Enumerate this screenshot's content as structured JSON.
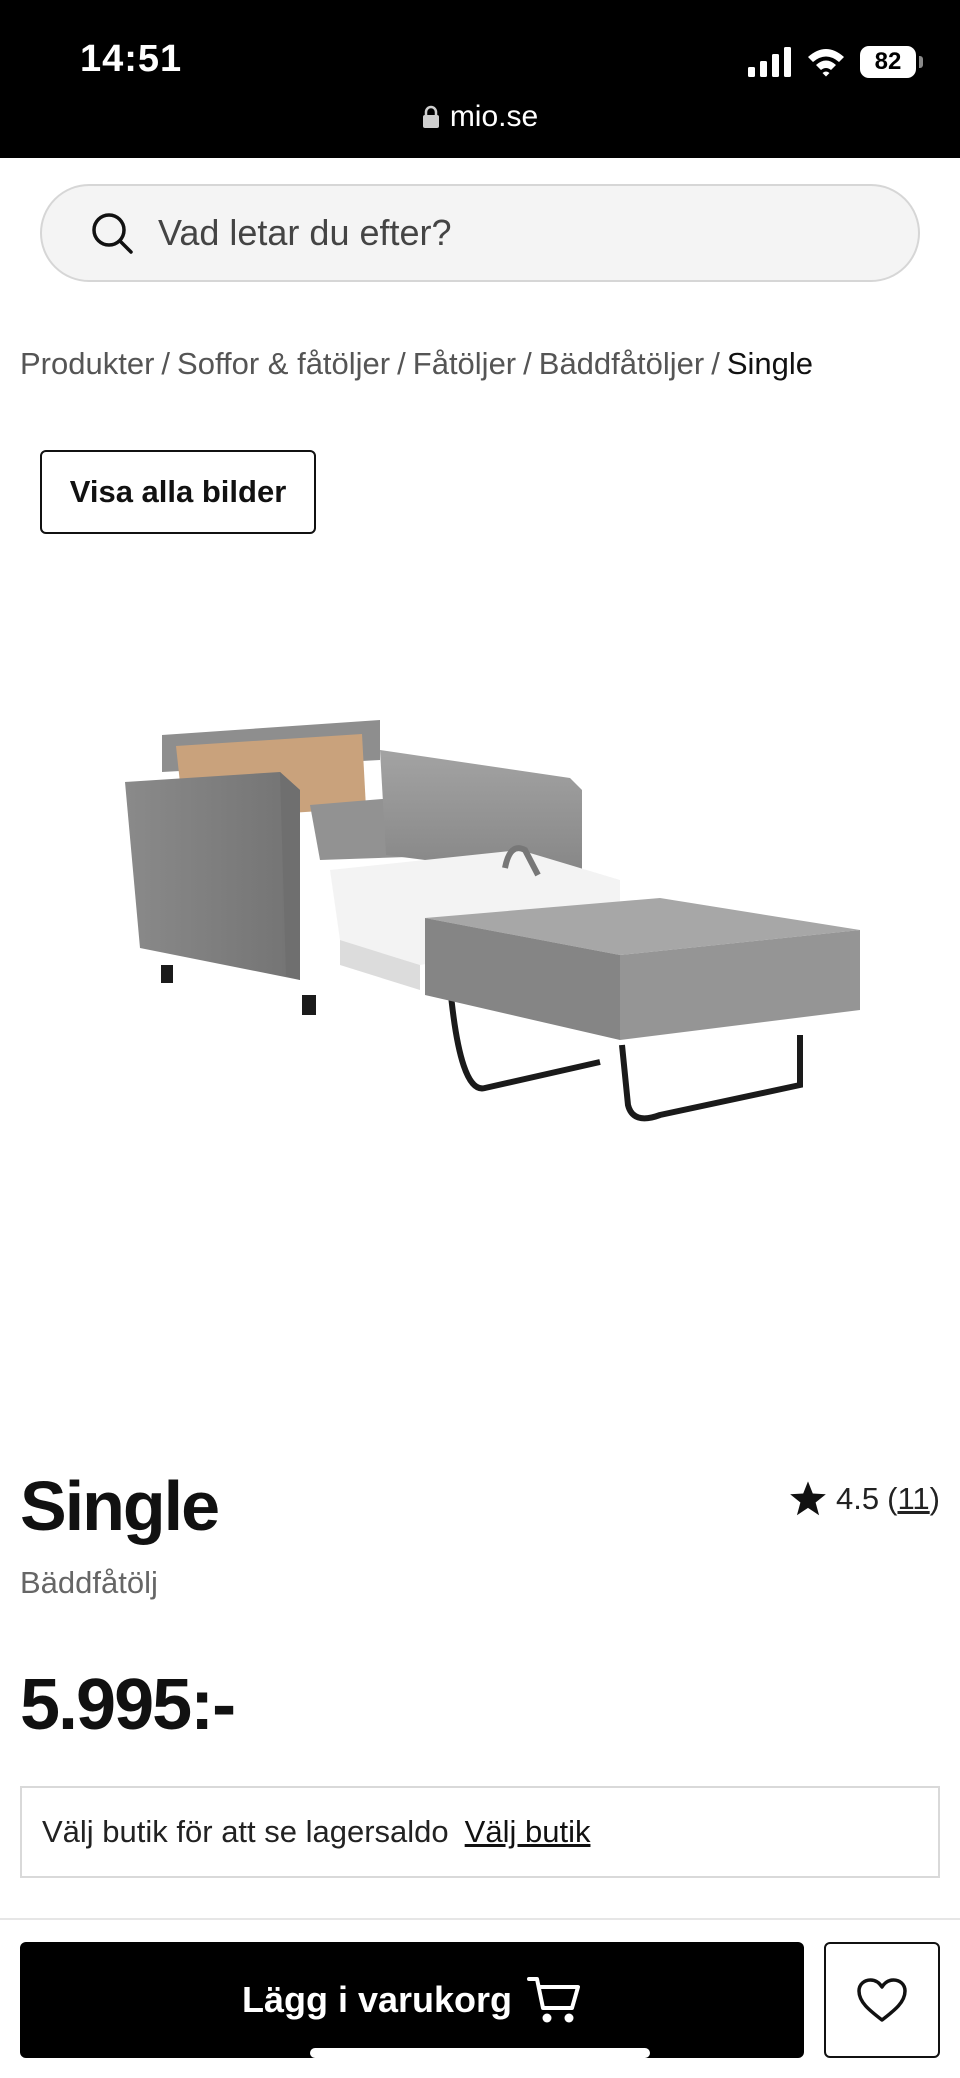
{
  "status_bar": {
    "time": "14:51",
    "battery": "82",
    "url": "mio.se",
    "icons": [
      "signal-icon",
      "wifi-icon",
      "battery-icon",
      "lock-icon"
    ]
  },
  "search": {
    "placeholder": "Vad letar du efter?",
    "icon": "search-icon"
  },
  "breadcrumb": {
    "items": [
      "Produkter",
      "Soffor & fåtöljer",
      "Fåtöljer",
      "Bäddfåtöljer"
    ],
    "current": "Single",
    "separator": "/"
  },
  "gallery": {
    "show_all_label": "Visa alla bilder"
  },
  "product": {
    "title": "Single",
    "subtitle": "Bäddfåtölj",
    "rating": "4.5",
    "rating_count": "11",
    "rating_open": "(",
    "rating_close": ")",
    "price": "5.995:-"
  },
  "store": {
    "text": "Välj butik för att se lagersaldo",
    "link": "Välj butik"
  },
  "actions": {
    "add_to_cart": "Lägg i varukorg",
    "cart_icon": "cart-icon",
    "favorite_icon": "heart-icon"
  },
  "colors": {
    "primary": "#000000",
    "background": "#ffffff",
    "muted_text": "#666666",
    "border": "#d9d9d9"
  }
}
